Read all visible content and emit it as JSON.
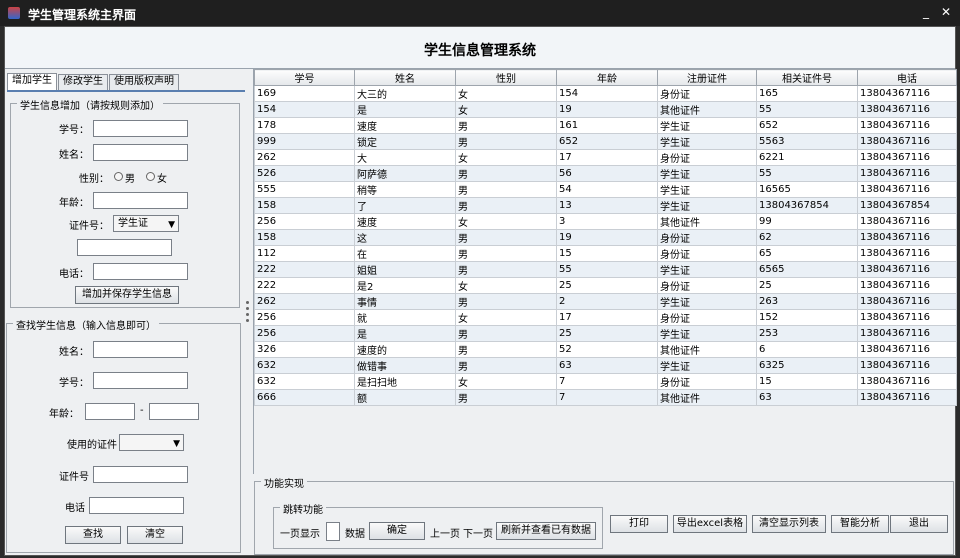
{
  "window": {
    "title": "学生管理系统主界面",
    "minimize": "_",
    "close": "✕"
  },
  "header": {
    "title": "学生信息管理系统"
  },
  "tabs": [
    "增加学生",
    "修改学生",
    "使用版权声明"
  ],
  "add_form": {
    "legend": "学生信息增加（请按规则添加）",
    "id_label": "学号：",
    "name_label": "姓名：",
    "gender_label": "性别：",
    "male": "男",
    "female": "女",
    "age_label": "年龄：",
    "cert_label": "证件号：",
    "cert_type": "学生证",
    "phone_label": "电话：",
    "submit": "增加并保存学生信息"
  },
  "search_form": {
    "legend": "查找学生信息（输入信息即可）",
    "name_label": "姓名：",
    "id_label": "学号：",
    "age_label": "年龄：",
    "age_sep": "-",
    "cert_type_label": "使用的证件",
    "cert_no_label": "证件号",
    "phone_label": "电话",
    "search": "查找",
    "clear": "清空"
  },
  "table": {
    "headers": [
      "学号",
      "姓名",
      "性别",
      "年龄",
      "注册证件",
      "相关证件号",
      "电话"
    ],
    "rows": [
      [
        "169",
        "大三的",
        "女",
        "154",
        "身份证",
        "165",
        "13804367116"
      ],
      [
        "154",
        "是",
        "女",
        "19",
        "其他证件",
        "55",
        "13804367116"
      ],
      [
        "178",
        "速度",
        "男",
        "161",
        "学生证",
        "652",
        "13804367116"
      ],
      [
        "999",
        "锁定",
        "男",
        "652",
        "学生证",
        "5563",
        "13804367116"
      ],
      [
        "262",
        "大",
        "女",
        "17",
        "身份证",
        "6221",
        "13804367116"
      ],
      [
        "526",
        "阿萨德",
        "男",
        "56",
        "学生证",
        "55",
        "13804367116"
      ],
      [
        "555",
        "稍等",
        "男",
        "54",
        "学生证",
        "16565",
        "13804367116"
      ],
      [
        "158",
        "了",
        "男",
        "13",
        "学生证",
        "13804367854",
        "13804367854"
      ],
      [
        "256",
        "速度",
        "女",
        "3",
        "其他证件",
        "99",
        "13804367116"
      ],
      [
        "158",
        "这",
        "男",
        "19",
        "身份证",
        "62",
        "13804367116"
      ],
      [
        "112",
        "在",
        "男",
        "15",
        "身份证",
        "65",
        "13804367116"
      ],
      [
        "222",
        "姐姐",
        "男",
        "55",
        "学生证",
        "6565",
        "13804367116"
      ],
      [
        "222",
        "是2",
        "女",
        "25",
        "身份证",
        "25",
        "13804367116"
      ],
      [
        "262",
        "事情",
        "男",
        "2",
        "学生证",
        "263",
        "13804367116"
      ],
      [
        "256",
        "就",
        "女",
        "17",
        "身份证",
        "152",
        "13804367116"
      ],
      [
        "256",
        "是",
        "男",
        "25",
        "学生证",
        "253",
        "13804367116"
      ],
      [
        "326",
        "速度的",
        "男",
        "52",
        "其他证件",
        "6",
        "13804367116"
      ],
      [
        "632",
        "做错事",
        "男",
        "63",
        "学生证",
        "6325",
        "13804367116"
      ],
      [
        "632",
        "是扫扫地",
        "女",
        "7",
        "身份证",
        "15",
        "13804367116"
      ],
      [
        "666",
        "额",
        "男",
        "7",
        "其他证件",
        "63",
        "13804367116"
      ]
    ]
  },
  "functions": {
    "legend": "功能实现",
    "jump_legend": "跳转功能",
    "per_page_label": "一页显示",
    "data_label": "数据",
    "confirm": "确定",
    "prev": "上一页",
    "next": "下一页",
    "refresh": "刷新并查看已有数据",
    "print": "打印",
    "export": "导出excel表格",
    "clear_list": "清空显示列表",
    "analysis": "智能分析",
    "exit": "退出"
  }
}
